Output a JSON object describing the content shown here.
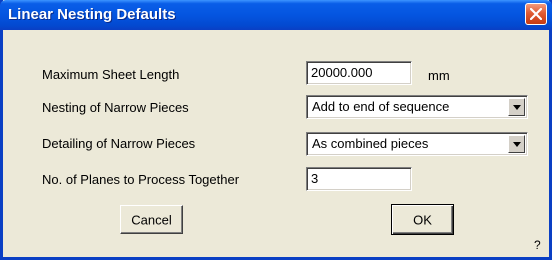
{
  "window": {
    "title": "Linear Nesting Defaults"
  },
  "icons": {
    "close": "close-icon",
    "dropdown": "chevron-down-icon"
  },
  "colors": {
    "titlebar": "#0455e0",
    "close_button": "#e05b34",
    "dialog_background": "#ece9d8"
  },
  "form": {
    "max_sheet_length": {
      "label": "Maximum Sheet Length",
      "value": "20000.000",
      "unit": "mm"
    },
    "nesting_narrow": {
      "label": "Nesting of Narrow Pieces",
      "selected": "Add to end of sequence"
    },
    "detailing_narrow": {
      "label": "Detailing of Narrow Pieces",
      "selected": "As combined pieces"
    },
    "planes_together": {
      "label": "No. of Planes to Process Together",
      "value": "3"
    }
  },
  "buttons": {
    "cancel": "Cancel",
    "ok": "OK"
  },
  "help_mark": "?"
}
